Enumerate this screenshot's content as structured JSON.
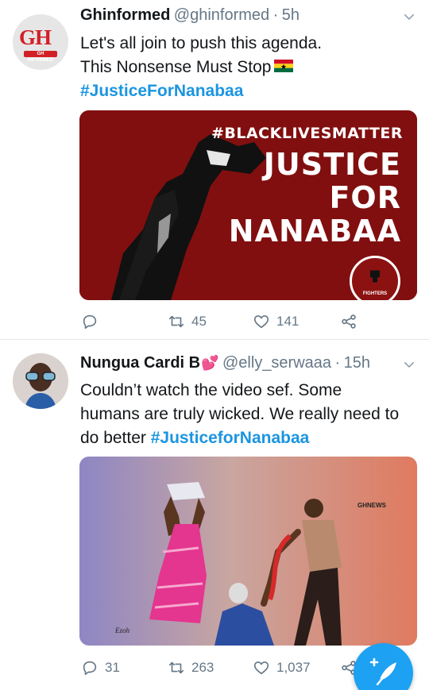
{
  "tweets": [
    {
      "display_name": "Ghinformed",
      "handle": "@ghinformed",
      "separator": "·",
      "time": "5h",
      "avatar": {
        "logo_text": "GH",
        "logo_sub": "GH INFORMED"
      },
      "text_lines": [
        "Let's all join to push this agenda.",
        "This  Nonsense Must Stop"
      ],
      "hashtag": "#JusticeForNanabaa",
      "flag_emoji": "ghana-flag",
      "media": {
        "tag": "#BLACKLIVESMATTER",
        "line1": "JUSTICE",
        "line2": "FOR",
        "line3": "NANABAA",
        "badge": "FIGHTERS",
        "bg_color": "#8c1212"
      },
      "actions": {
        "reply": "",
        "retweet": "45",
        "like": "141"
      }
    },
    {
      "display_name": "Nungua Cardi B",
      "name_emoji": "💕",
      "handle": "@elly_serwaaa",
      "separator": "·",
      "time": "15h",
      "text_lines": [
        "Couldn’t watch the video sef. Some",
        "humans are truly wicked. We really need to",
        "do better"
      ],
      "hashtag": "#JusticeforNanabaa",
      "media": {
        "watermark": "GHNEWS",
        "signature": "Ezoh"
      },
      "actions": {
        "reply": "31",
        "retweet": "263",
        "like": "1,037"
      }
    }
  ],
  "colors": {
    "accent": "#1da1f2",
    "link": "#1b95e0",
    "muted": "#657786",
    "text": "#14171a"
  },
  "compose_button": {
    "icon": "compose-feather-plus-icon"
  }
}
